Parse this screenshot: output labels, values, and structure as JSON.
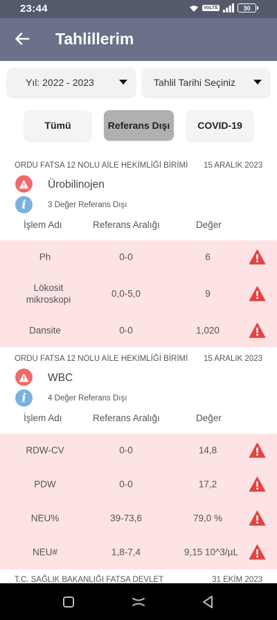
{
  "status_bar": {
    "time": "23:44",
    "network_badge": "VoLTE",
    "battery": "30"
  },
  "app_bar": {
    "title": "Tahlillerim",
    "back_icon": "arrow-left-icon"
  },
  "filters": {
    "year": "Yıl: 2022 - 2023",
    "date": "Tahlil Tarihi Seçiniz"
  },
  "tabs": [
    {
      "label": "Tümü",
      "active": false
    },
    {
      "label": "Referans Dışı",
      "active": true
    },
    {
      "label": "COVID-19",
      "active": false
    }
  ],
  "columns": {
    "name": "İşlem Adı",
    "range": "Referans Aralığı",
    "value": "Değer"
  },
  "results": [
    {
      "institution": "ORDU FATSA 12 NOLU AİLE HEKİMLİĞİ BİRİMİ",
      "date": "15 ARALIK 2023",
      "test": "Ürobilinojen",
      "info": "3 Değer Referans Dışı",
      "rows": [
        {
          "name": "Ph",
          "range": "0-0",
          "value": "6"
        },
        {
          "name": "Lökosit mikroskopi",
          "range": "0,0-5,0",
          "value": "9"
        },
        {
          "name": "Dansite",
          "range": "0-0",
          "value": "1,020"
        }
      ]
    },
    {
      "institution": "ORDU FATSA 12 NOLU AİLE HEKİMLİĞİ BİRİMİ",
      "date": "15 ARALIK 2023",
      "test": "WBC",
      "info": "4 Değer Referans Dışı",
      "rows": [
        {
          "name": "RDW-CV",
          "range": "0-0",
          "value": "14,8"
        },
        {
          "name": "PDW",
          "range": "0-0",
          "value": "17,2"
        },
        {
          "name": "NEU%",
          "range": "39-73,6",
          "value": "79,0 %"
        },
        {
          "name": "NEU#",
          "range": "1,8-7,4",
          "value": "9,15 10^3/µL"
        }
      ]
    },
    {
      "institution": "T.C. SAĞLIK BAKANLIĞI FATSA DEVLET",
      "date": "31 EKİM 2023"
    }
  ],
  "colors": {
    "appbar": "#6a7189",
    "warning": "#f06a6a",
    "row_alert_bg": "#fde3e3",
    "info": "#7ab2dd"
  }
}
